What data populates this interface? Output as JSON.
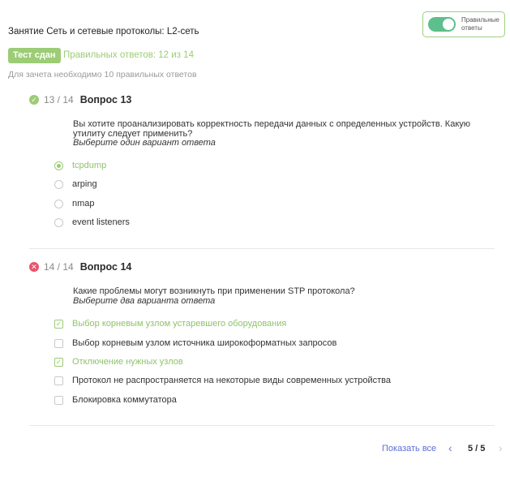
{
  "toggle": {
    "label": "Правильные ответы",
    "enabled": true
  },
  "header": {
    "lesson_title": "Занятие Сеть и сетевые протоколы: L2-сеть",
    "status_badge": "Тест сдан",
    "score": "Правильных ответов: 12 из 14",
    "requirement": "Для зачета необходимо 10 правильных ответов"
  },
  "questions": [
    {
      "counter": "13 / 14",
      "title": "Вопрос 13",
      "status": "correct",
      "status_icon": "check-circle-icon",
      "text": "Вы хотите проанализировать корректность передачи данных с определенных устройств. Какую утилиту следует применить?",
      "hint": "Выберите один вариант ответа",
      "options": [
        {
          "label": "tcpdump",
          "selected": true,
          "correct": true
        },
        {
          "label": "arping",
          "selected": false,
          "correct": false
        },
        {
          "label": "nmap",
          "selected": false,
          "correct": false
        },
        {
          "label": "event listeners",
          "selected": false,
          "correct": false
        }
      ]
    },
    {
      "counter": "14 / 14",
      "title": "Вопрос 14",
      "status": "incorrect",
      "status_icon": "x-circle-icon",
      "text": "Какие проблемы могут возникнуть при применении STP протокола?",
      "hint": "Выберите два варианта ответа",
      "options": [
        {
          "label": "Выбор корневым узлом устаревшего оборудования",
          "selected": true,
          "correct": true
        },
        {
          "label": "Выбор корневым узлом источника широкоформатных запросов",
          "selected": false,
          "correct": false
        },
        {
          "label": "Отключение нужных узлов",
          "selected": true,
          "correct": true
        },
        {
          "label": "Протокол не распространяется на некоторые виды современных устройства",
          "selected": false,
          "correct": false
        },
        {
          "label": "Блокировка коммутатора",
          "selected": false,
          "correct": false
        }
      ]
    }
  ],
  "pagination": {
    "show_all": "Показать все",
    "page": "5 / 5",
    "prev_icon": "chevron-left-icon",
    "next_icon": "chevron-right-icon"
  },
  "colors": {
    "success": "#9ccc75",
    "error": "#e8546b",
    "toggle": "#5dbf8b",
    "link": "#5b6fd6"
  }
}
